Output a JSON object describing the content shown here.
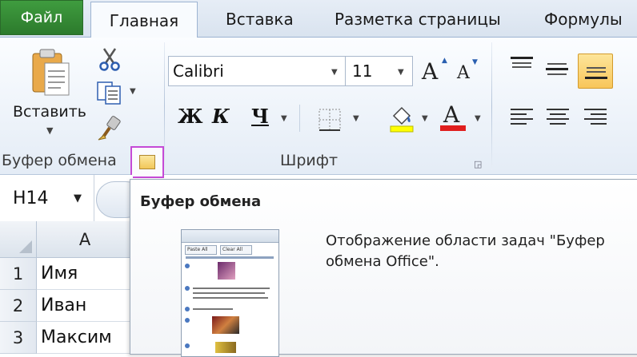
{
  "tabs": {
    "file": "Файл",
    "home": "Главная",
    "insert": "Вставка",
    "page_layout": "Разметка страницы",
    "formulas": "Формулы"
  },
  "clipboard_group": {
    "label": "Буфер обмена",
    "paste_label": "Вставить",
    "icons": [
      "paste-icon",
      "cut-icon",
      "copy-icon",
      "format-painter-icon",
      "dialog-launcher-icon"
    ]
  },
  "font_group": {
    "label": "Шрифт",
    "font_name": "Calibri",
    "font_size": "11",
    "bold": "Ж",
    "italic": "К",
    "underline": "Ч",
    "grow": "A",
    "shrink": "A",
    "font_color_letter": "A",
    "fill_color": "#ffff00",
    "font_color": "#e01e1e"
  },
  "alignment_group": {
    "active": "align-bottom",
    "active_color": "#f8c65a"
  },
  "name_box": {
    "value": "H14"
  },
  "grid": {
    "column_header": "A",
    "rows": [
      {
        "num": "1",
        "a": "Имя"
      },
      {
        "num": "2",
        "a": "Иван"
      },
      {
        "num": "3",
        "a": "Максим"
      }
    ]
  },
  "tooltip": {
    "title": "Буфер обмена",
    "description": "Отображение области задач \"Буфер обмена Office\".",
    "pane_buttons": [
      "Paste All",
      "Clear All"
    ]
  }
}
